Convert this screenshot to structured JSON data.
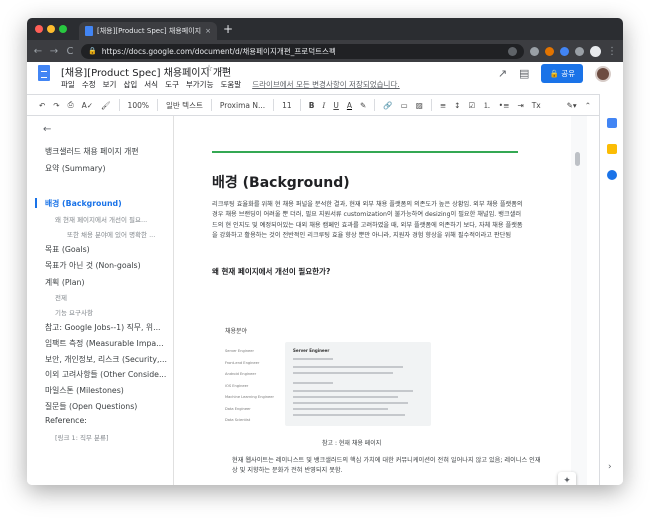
{
  "browser": {
    "tab_title": "[채용][Product Spec] 채용페이지 개",
    "tab_close": "×",
    "new_tab": "+",
    "url": "https://docs.google.com/document/d/채용페이지개편_프로덕트스펙",
    "nav": {
      "back": "←",
      "forward": "→",
      "reload": "C"
    }
  },
  "docs": {
    "title": "[채용][Product Spec] 채용페이지 개편",
    "menu": [
      "파일",
      "수정",
      "보기",
      "삽입",
      "서식",
      "도구",
      "부가기능",
      "도움말"
    ],
    "saved_message": "드라이브에서 모든 변경사항이 저장되었습니다.",
    "share_label": "공유"
  },
  "toolbar": {
    "zoom": "100%",
    "style": "일반 텍스트",
    "font": "Proxima N...",
    "size": "11",
    "bold": "B",
    "italic": "I",
    "underline": "U",
    "textcolor": "A"
  },
  "outline": {
    "items": [
      {
        "label": "뱅크샐러드 채용 페이지 개편",
        "level": 0
      },
      {
        "label": "요약 (Summary)",
        "level": 0
      },
      {
        "label": "배경 (Background)",
        "level": 0,
        "active": true
      },
      {
        "label": "왜 현재 페이지에서 개선이 필요...",
        "level": 1
      },
      {
        "label": "또한 채용 분야에 있어 명확한 ...",
        "level": 2
      },
      {
        "label": "목표 (Goals)",
        "level": 0
      },
      {
        "label": "목표가 아닌 것 (Non-goals)",
        "level": 0
      },
      {
        "label": "계획 (Plan)",
        "level": 0
      },
      {
        "label": "전제",
        "level": 1
      },
      {
        "label": "기능 요구사항",
        "level": 1
      },
      {
        "label": "참고: Google Jobs--1) 직무, 위...",
        "level": 0
      },
      {
        "label": "임팩트 측정 (Measurable Impa...",
        "level": 0
      },
      {
        "label": "보안, 개인정보, 리스크 (Security,...",
        "level": 0
      },
      {
        "label": "이외 고려사항들 (Other Conside...",
        "level": 0
      },
      {
        "label": "마일스톤 (Milestones)",
        "level": 0
      },
      {
        "label": "질문들 (Open Questions)",
        "level": 0
      },
      {
        "label": "Reference:",
        "level": 0
      },
      {
        "label": "[링크 1: 직무 분류]",
        "level": 1
      }
    ]
  },
  "document": {
    "heading": "배경 (Background)",
    "paragraph": "리크루팅 효율화를 위해 현 채용 퍼널을 분석한 결과, 현재 외부 채용 플랫폼의 의존도가 높은 상황임. 외부 채용 플랫폼의 경우 채용 브랜딩이 어려울 뿐 더러, 필요 지원서류 customization이 불가능하여 desizing이 필요한 채널임. 뱅크샐러드의 현 인지도 및 예정되어있는 대외 채용 캠페인 효과를 고려하였을 때, 외부 플랫폼에 의존하기 보다, 자체 채용 플랫폼을 강화하고 활용하는 것이 전반적인 리크루팅 효율 향상 뿐만 아니라, 지원자 경험 향상을 위해 필수적이라고 판단됨",
    "subheading": "왜 현재 페이지에서 개선이 필요한가?",
    "figure": {
      "title": "채용분야",
      "list": [
        "Server Engineer",
        "Front-end Engineer",
        "Android Engineer",
        "iOS Engineer",
        "Machine Learning Engineer",
        "Data Engineer",
        "Data Scientist"
      ],
      "panel_title": "Server Engineer"
    },
    "caption": "참고 : 현재 채용 페이지",
    "paragraph2": "현재 웹사이트는 레이니스트 및 뱅크샐러드의 핵심 가치에 대한 커뮤니케이션이 전혀 일어나지 않고 있음; 레이니스 인재상 및 지향하는 문화가 전혀 반영되지 못함."
  }
}
